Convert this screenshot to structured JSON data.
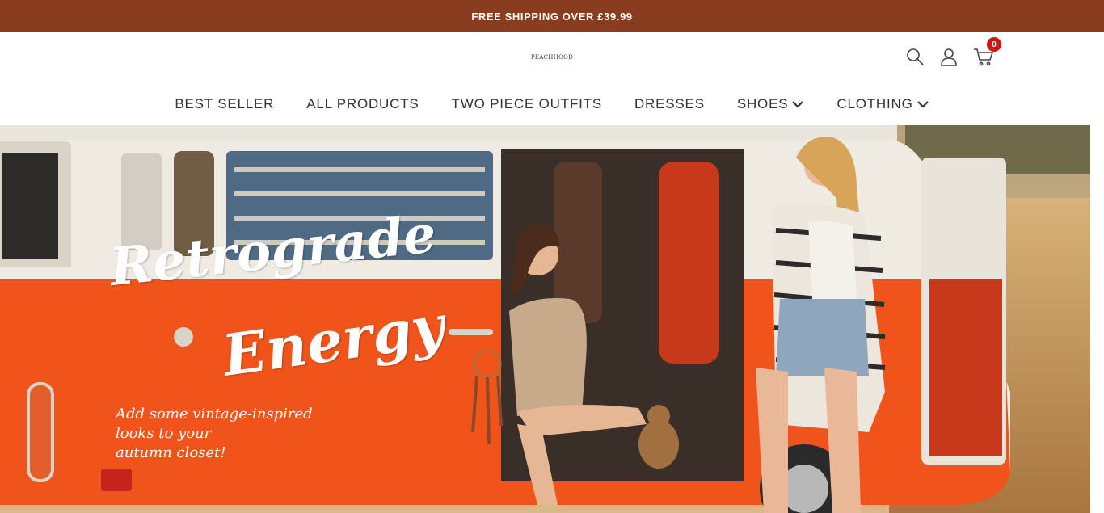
{
  "announcement": "FREE SHIPPING OVER  £39.99",
  "logo": "PEACHHOOD",
  "header_icons": {
    "search": "search-icon",
    "account": "user-icon",
    "cart": "cart-icon",
    "cart_count": "0"
  },
  "nav": {
    "items": [
      {
        "label": "BEST SELLER",
        "dropdown": false
      },
      {
        "label": "ALL PRODUCTS",
        "dropdown": false
      },
      {
        "label": "TWO PIECE OUTFITS",
        "dropdown": false
      },
      {
        "label": "DRESSES",
        "dropdown": false
      },
      {
        "label": "SHOES",
        "dropdown": true
      },
      {
        "label": "CLOTHING",
        "dropdown": true
      }
    ]
  },
  "hero": {
    "title_line1": "Retrograde",
    "title_line2": "Energy",
    "subtitle_line1": "Add some vintage-inspired",
    "subtitle_line2": "looks to your",
    "subtitle_line3": "autumn closet!"
  },
  "colors": {
    "announce_bg": "#8a3c1e",
    "badge": "#d41414",
    "van_orange": "#f0541a"
  }
}
